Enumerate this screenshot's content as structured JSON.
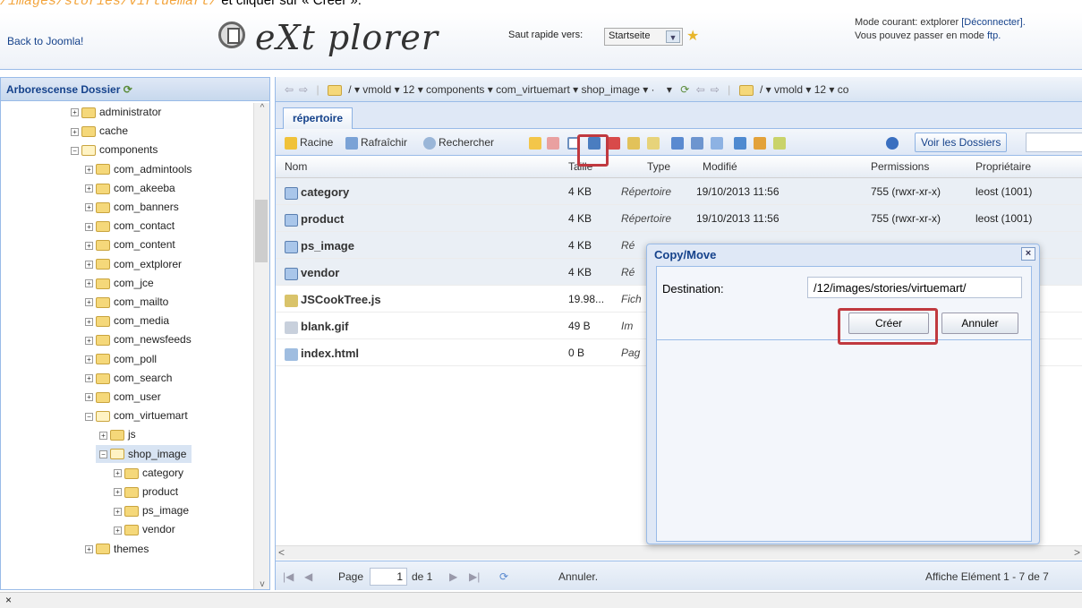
{
  "caption": {
    "path": "/images/stories/virtuemart/",
    "rest": " et cliquer sur « Créer »."
  },
  "header": {
    "back_link": "Back to Joomla!",
    "logo_text": "eXt plorer",
    "quick_jump_label": "Saut rapide vers:",
    "quick_jump_value": "Startseite",
    "mode_line1": "Mode courant: extplorer",
    "disconnect_link": "[Déconnecter].",
    "mode_line2": "Vous pouvez passer en mode",
    "ftp_link": "ftp."
  },
  "sidebar": {
    "title": "Arborescense Dossier",
    "items": [
      {
        "label": "administrator",
        "pm": "+",
        "open": false
      },
      {
        "label": "cache",
        "pm": "+",
        "open": false
      },
      {
        "label": "components",
        "pm": "−",
        "open": true
      },
      {
        "label": "com_admintools",
        "pm": "+",
        "open": false
      },
      {
        "label": "com_akeeba",
        "pm": "+",
        "open": false
      },
      {
        "label": "com_banners",
        "pm": "+",
        "open": false
      },
      {
        "label": "com_contact",
        "pm": "+",
        "open": false
      },
      {
        "label": "com_content",
        "pm": "+",
        "open": false
      },
      {
        "label": "com_extplorer",
        "pm": "+",
        "open": false
      },
      {
        "label": "com_jce",
        "pm": "+",
        "open": false
      },
      {
        "label": "com_mailto",
        "pm": "+",
        "open": false
      },
      {
        "label": "com_media",
        "pm": "+",
        "open": false
      },
      {
        "label": "com_newsfeeds",
        "pm": "+",
        "open": false
      },
      {
        "label": "com_poll",
        "pm": "+",
        "open": false
      },
      {
        "label": "com_search",
        "pm": "+",
        "open": false
      },
      {
        "label": "com_user",
        "pm": "+",
        "open": false
      },
      {
        "label": "com_virtuemart",
        "pm": "−",
        "open": true
      },
      {
        "label": "js",
        "pm": "+",
        "open": false
      },
      {
        "label": "shop_image",
        "pm": "−",
        "open": true,
        "selected": true
      },
      {
        "label": "category",
        "pm": "+",
        "open": false
      },
      {
        "label": "product",
        "pm": "+",
        "open": false
      },
      {
        "label": "ps_image",
        "pm": "+",
        "open": false
      },
      {
        "label": "vendor",
        "pm": "+",
        "open": false
      },
      {
        "label": "themes",
        "pm": "+",
        "open": false
      }
    ]
  },
  "location": {
    "left": "/ ▾  vmold ▾  12 ▾  components ▾  com_virtuemart ▾  shop_image ▾ ·",
    "right": "/ ▾  vmold ▾  12 ▾  co"
  },
  "tab_label": "répertoire",
  "toolbar": {
    "root": "Racine",
    "refresh": "Rafraîchir",
    "search": "Rechercher",
    "show_dirs": "Voir les Dossiers"
  },
  "columns": [
    "Nom",
    "Taille",
    "Type",
    "Modifié",
    "Permissions",
    "Propriétaire"
  ],
  "files": [
    {
      "name": "category",
      "size": "4 KB",
      "type": "Répertoire",
      "modified": "19/10/2013 11:56",
      "perms": "755 (rwxr-xr-x)",
      "owner": "leost (1001)",
      "kind": "folder"
    },
    {
      "name": "product",
      "size": "4 KB",
      "type": "Répertoire",
      "modified": "19/10/2013 11:56",
      "perms": "755 (rwxr-xr-x)",
      "owner": "leost (1001)",
      "kind": "folder"
    },
    {
      "name": "ps_image",
      "size": "4 KB",
      "type": "Ré",
      "modified": "",
      "perms": "",
      "owner": "",
      "kind": "folder"
    },
    {
      "name": "vendor",
      "size": "4 KB",
      "type": "Ré",
      "modified": "",
      "perms": "",
      "owner": "",
      "kind": "folder"
    },
    {
      "name": "JSCookTree.js",
      "size": "19.98...",
      "type": "Fich",
      "modified": "",
      "perms": "",
      "owner": "",
      "kind": "js"
    },
    {
      "name": "blank.gif",
      "size": "49 B",
      "type": "Im",
      "modified": "",
      "perms": "",
      "owner": "",
      "kind": "gif"
    },
    {
      "name": "index.html",
      "size": "0 B",
      "type": "Pag",
      "modified": "",
      "perms": "",
      "owner": "",
      "kind": "html"
    }
  ],
  "pager": {
    "page_label": "Page",
    "page_value": "1",
    "of_label": "de 1",
    "cancel": "Annuler.",
    "summary": "Affiche Elément 1 - 7 de 7"
  },
  "status_close": "×",
  "dialog": {
    "title": "Copy/Move",
    "close": "×",
    "destination_label": "Destination:",
    "destination_value": "/12/images/stories/virtuemart/",
    "create_button": "Créer",
    "cancel_button": "Annuler"
  },
  "colors": {
    "highlight": "#c0393f",
    "accent": "#15428b"
  }
}
